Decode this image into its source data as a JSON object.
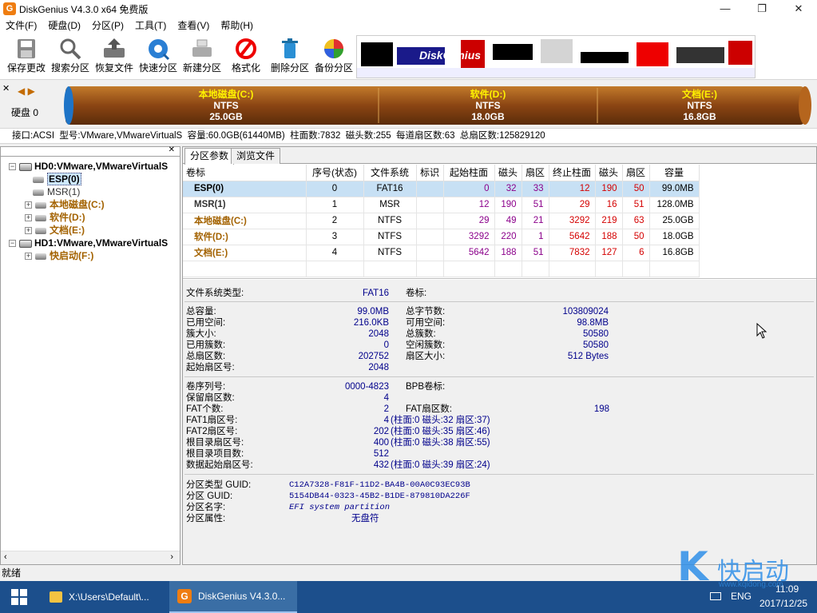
{
  "window": {
    "title": "DiskGenius V4.3.0 x64 免费版",
    "icon_text": "G"
  },
  "menu": [
    "文件(F)",
    "硬盘(D)",
    "分区(P)",
    "工具(T)",
    "查看(V)",
    "帮助(H)"
  ],
  "toolbar": [
    {
      "label": "保存更改",
      "icon": "save-icon"
    },
    {
      "label": "搜索分区",
      "icon": "search-icon"
    },
    {
      "label": "恢复文件",
      "icon": "recover-icon"
    },
    {
      "label": "快速分区",
      "icon": "quick-partition-icon"
    },
    {
      "label": "新建分区",
      "icon": "new-partition-icon"
    },
    {
      "label": "格式化",
      "icon": "format-icon"
    },
    {
      "label": "删除分区",
      "icon": "delete-icon"
    },
    {
      "label": "备份分区",
      "icon": "backup-icon"
    }
  ],
  "diskbar": {
    "disk_label": "硬盘 0",
    "partitions": [
      {
        "label": "本地磁盘(C:)",
        "fs": "NTFS",
        "size": "25.0GB"
      },
      {
        "label": "软件(D:)",
        "fs": "NTFS",
        "size": "18.0GB"
      },
      {
        "label": "文档(E:)",
        "fs": "NTFS",
        "size": "16.8GB"
      }
    ]
  },
  "infoline": "接口:ACSI  型号:VMware,VMwareVirtualS  容量:60.0GB(61440MB)  柱面数:7832  磁头数:255  每道扇区数:63  总扇区数:125829120",
  "tree": [
    {
      "label": "HD0:VMware,VMwareVirtualS",
      "kind": "disk",
      "exp": "−",
      "color": "black"
    },
    {
      "label": "ESP(0)",
      "kind": "part",
      "exp": "",
      "color": "black",
      "selected": true
    },
    {
      "label": "MSR(1)",
      "kind": "part",
      "exp": "",
      "color": "grey"
    },
    {
      "label": "本地磁盘(C:)",
      "kind": "part",
      "exp": "+",
      "color": "gold"
    },
    {
      "label": "软件(D:)",
      "kind": "part",
      "exp": "+",
      "color": "gold"
    },
    {
      "label": "文档(E:)",
      "kind": "part",
      "exp": "+",
      "color": "gold"
    },
    {
      "label": "HD1:VMware,VMwareVirtualS",
      "kind": "disk",
      "exp": "−",
      "color": "black"
    },
    {
      "label": "快启动(F:)",
      "kind": "part",
      "exp": "+",
      "color": "gold"
    }
  ],
  "tabs": [
    "分区参数",
    "浏览文件"
  ],
  "table": {
    "headers": [
      "卷标",
      "序号(状态)",
      "文件系统",
      "标识",
      "起始柱面",
      "磁头",
      "扇区",
      "终止柱面",
      "磁头",
      "扇区",
      "容量"
    ],
    "rows": [
      {
        "name": "ESP(0)",
        "num": "0",
        "fs": "FAT16",
        "id": "",
        "sc": "0",
        "sh": "32",
        "ss": "33",
        "ec": "12",
        "eh": "190",
        "es": "50",
        "cap": "99.0MB",
        "color": "black",
        "selected": true
      },
      {
        "name": "MSR(1)",
        "num": "1",
        "fs": "MSR",
        "id": "",
        "sc": "12",
        "sh": "190",
        "ss": "51",
        "ec": "29",
        "eh": "16",
        "es": "51",
        "cap": "128.0MB",
        "color": "grey"
      },
      {
        "name": "本地磁盘(C:)",
        "num": "2",
        "fs": "NTFS",
        "id": "",
        "sc": "29",
        "sh": "49",
        "ss": "21",
        "ec": "3292",
        "eh": "219",
        "es": "63",
        "cap": "25.0GB",
        "color": "gold"
      },
      {
        "name": "软件(D:)",
        "num": "3",
        "fs": "NTFS",
        "id": "",
        "sc": "3292",
        "sh": "220",
        "ss": "1",
        "ec": "5642",
        "eh": "188",
        "es": "50",
        "cap": "18.0GB",
        "color": "gold"
      },
      {
        "name": "文档(E:)",
        "num": "4",
        "fs": "NTFS",
        "id": "",
        "sc": "5642",
        "sh": "188",
        "ss": "51",
        "ec": "7832",
        "eh": "127",
        "es": "6",
        "cap": "16.8GB",
        "color": "gold"
      }
    ]
  },
  "details": {
    "fs_type_label": "文件系统类型:",
    "fs_type": "FAT16",
    "vol_label_label": "卷标:",
    "left1": [
      [
        "总容量:",
        "99.0MB"
      ],
      [
        "已用空间:",
        "216.0KB"
      ],
      [
        "簇大小:",
        "2048"
      ],
      [
        "已用簇数:",
        "0"
      ],
      [
        "总扇区数:",
        "202752"
      ],
      [
        "起始扇区号:",
        "2048"
      ]
    ],
    "right1": [
      [
        "总字节数:",
        "103809024"
      ],
      [
        "可用空间:",
        "98.8MB"
      ],
      [
        "总簇数:",
        "50580"
      ],
      [
        "空闲簇数:",
        "50580"
      ],
      [
        "扇区大小:",
        "512 Bytes"
      ]
    ],
    "left2": [
      [
        "卷序列号:",
        "0000-4823"
      ],
      [
        "保留扇区数:",
        "4"
      ],
      [
        "FAT个数:",
        "2"
      ],
      [
        "FAT1扇区号:",
        "4"
      ],
      [
        "FAT2扇区号:",
        "202"
      ],
      [
        "根目录扇区号:",
        "400"
      ],
      [
        "根目录项目数:",
        "512"
      ],
      [
        "数据起始扇区号:",
        "432"
      ]
    ],
    "left2_extra": [
      "",
      "",
      "",
      "(柱面:0 磁头:32 扇区:37)",
      "(柱面:0 磁头:35 扇区:46)",
      "(柱面:0 磁头:38 扇区:55)",
      "",
      "(柱面:0 磁头:39 扇区:24)"
    ],
    "bpb_label": "BPB卷标:",
    "fat_sectors_label": "FAT扇区数:",
    "fat_sectors": "198",
    "guid": [
      [
        "分区类型 GUID:",
        "C12A7328-F81F-11D2-BA4B-00A0C93EC93B"
      ],
      [
        "分区 GUID:",
        "5154DB44-0323-45B2-B1DE-879810DA226F"
      ],
      [
        "分区名字:",
        "EFI system partition"
      ],
      [
        "分区属性:",
        "无盘符"
      ]
    ]
  },
  "status": "就绪",
  "taskbar": {
    "items": [
      "X:\\Users\\Default\\...",
      "DiskGenius V4.3.0..."
    ],
    "lang": "ENG",
    "time": "11:09",
    "date": "2017/12/25"
  },
  "watermark": {
    "letter": "K",
    "text": "快启动",
    "url": "www.kqidong.com"
  },
  "banner_text": "DiskGenius",
  "colors": {
    "partition_bar": "#8b4513",
    "accent_gold": "#a36200",
    "selection": "#c7e0f4",
    "taskbar": "#1c4f8c"
  }
}
